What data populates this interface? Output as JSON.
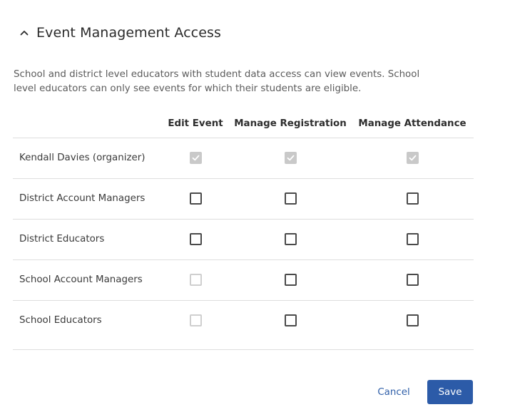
{
  "section": {
    "title": "Event Management Access",
    "toggle_icon": "chevron-up-icon",
    "description": "School and district level educators with student data access can view events. School level educators can only see events for which their students are eligible."
  },
  "table": {
    "columns": [
      "Edit Event",
      "Manage Registration",
      "Manage Attendance"
    ],
    "rows": [
      {
        "label": "Kendall Davies (organizer)",
        "cells": [
          {
            "checked": true,
            "disabled": true
          },
          {
            "checked": true,
            "disabled": true
          },
          {
            "checked": true,
            "disabled": true
          }
        ]
      },
      {
        "label": "District Account Managers",
        "cells": [
          {
            "checked": false,
            "disabled": false
          },
          {
            "checked": false,
            "disabled": false
          },
          {
            "checked": false,
            "disabled": false
          }
        ]
      },
      {
        "label": "District Educators",
        "cells": [
          {
            "checked": false,
            "disabled": false
          },
          {
            "checked": false,
            "disabled": false
          },
          {
            "checked": false,
            "disabled": false
          }
        ]
      },
      {
        "label": "School Account Managers",
        "cells": [
          {
            "checked": false,
            "disabled": true
          },
          {
            "checked": false,
            "disabled": false
          },
          {
            "checked": false,
            "disabled": false
          }
        ]
      },
      {
        "label": "School Educators",
        "cells": [
          {
            "checked": false,
            "disabled": true
          },
          {
            "checked": false,
            "disabled": false
          },
          {
            "checked": false,
            "disabled": false
          }
        ]
      }
    ]
  },
  "actions": {
    "cancel_label": "Cancel",
    "save_label": "Save"
  },
  "colors": {
    "primary": "#2c5ba8",
    "link": "#2e5ea8",
    "checkbox_border": "#4a4a4a",
    "checkbox_disabled": "#cfcfcf",
    "checkbox_checked_disabled": "#c9c9c9"
  }
}
